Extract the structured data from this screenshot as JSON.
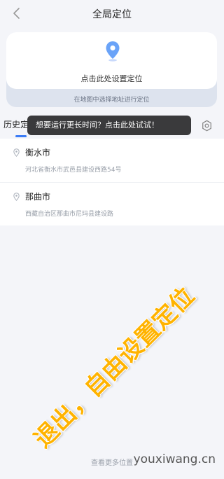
{
  "nav": {
    "title": "全局定位"
  },
  "card": {
    "label": "点击此处设置定位",
    "hint": "在地图中选择地址进行定位"
  },
  "tabs": {
    "history": "历史定位"
  },
  "tooltip": {
    "text": "想要运行更长时间？点击此处试试！"
  },
  "history": [
    {
      "city": "衡水市",
      "address": "河北省衡水市武邑县建设西路54号"
    },
    {
      "city": "那曲市",
      "address": "西藏自治区那曲市尼玛县建设路"
    }
  ],
  "bottom": {
    "link": "查看更多位置"
  },
  "watermark": {
    "text": "退出，自由设置定位",
    "site": "youxiwang.cn"
  },
  "colors": {
    "accent": "#3b7cf6",
    "tooltip_bg": "#3a3a3c",
    "watermark": "#ffb300"
  }
}
